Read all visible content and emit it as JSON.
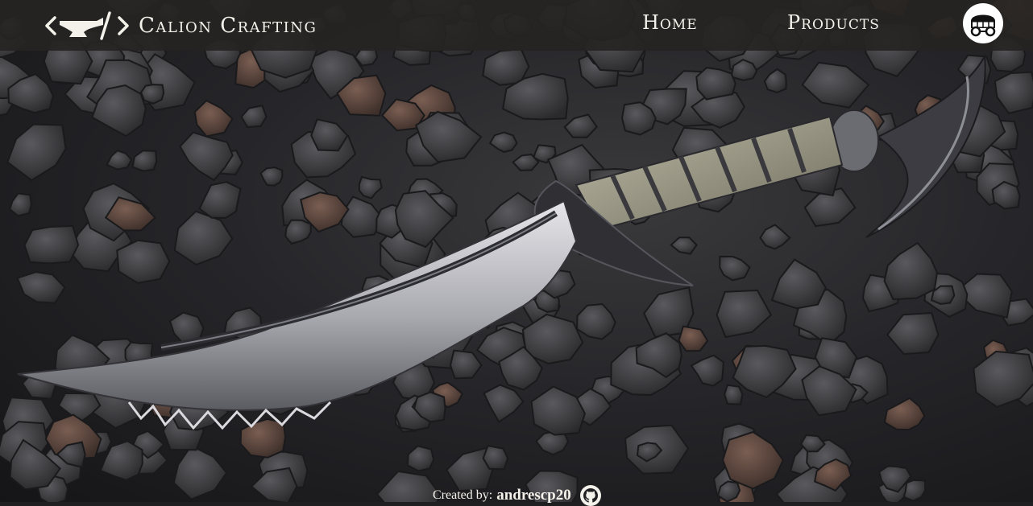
{
  "brand": {
    "name": "Calion Crafting",
    "logo_icon": "anvil-code-icon"
  },
  "nav": {
    "home_label": "Home",
    "products_label": "Products",
    "cart_icon": "cart-wagon-icon"
  },
  "hero": {
    "image_subject": "dagger-on-volcanic-rocks"
  },
  "footer": {
    "created_by_label": "Created by:",
    "author": "andrescp20",
    "github_icon": "github-icon"
  },
  "colors": {
    "nav_background": "#262422",
    "nav_text": "#f4f1ea",
    "cart_background": "#ffffff"
  }
}
